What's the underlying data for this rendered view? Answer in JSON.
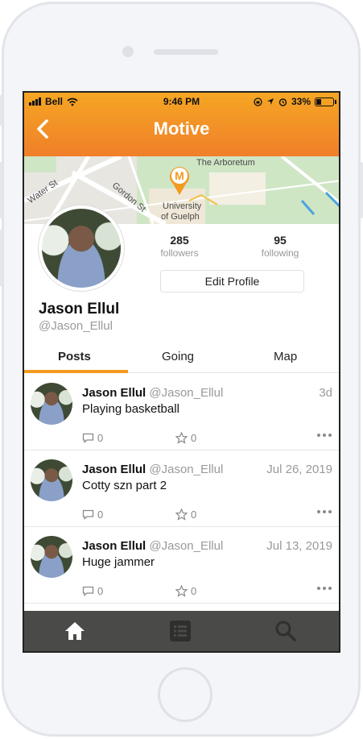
{
  "status_bar": {
    "carrier": "Bell",
    "time": "9:46 PM",
    "battery": "33%",
    "battery_level": 0.33
  },
  "header": {
    "title": "Motive",
    "back_icon": "chevron-left-icon"
  },
  "map": {
    "labels": [
      "The Arboretum",
      "Water St",
      "Gordon St",
      "University",
      "of Guelph"
    ],
    "marker_letter": "M"
  },
  "profile": {
    "name": "Jason Ellul",
    "handle": "@Jason_Ellul",
    "followers_count": "285",
    "followers_label": "followers",
    "following_count": "95",
    "following_label": "following",
    "edit_label": "Edit Profile"
  },
  "tabs": [
    {
      "label": "Posts",
      "active": true
    },
    {
      "label": "Going",
      "active": false
    },
    {
      "label": "Map",
      "active": false
    }
  ],
  "posts": [
    {
      "name": "Jason Ellul",
      "handle": "@Jason_Ellul",
      "time": "3d",
      "text": "Playing basketball",
      "comments": "0",
      "stars": "0"
    },
    {
      "name": "Jason Ellul",
      "handle": "@Jason_Ellul",
      "time": "Jul 26, 2019",
      "text": "Cotty szn part 2",
      "comments": "0",
      "stars": "0"
    },
    {
      "name": "Jason Ellul",
      "handle": "@Jason_Ellul",
      "time": "Jul 13, 2019",
      "text": "Huge jammer",
      "comments": "0",
      "stars": "0"
    }
  ],
  "bottom_nav": [
    "home-icon",
    "list-icon",
    "search-icon"
  ],
  "colors": {
    "accent": "#f39a1f",
    "header_top": "#f5a623",
    "header_bottom": "#f07f2a",
    "nav_bg": "#4a4a48"
  }
}
